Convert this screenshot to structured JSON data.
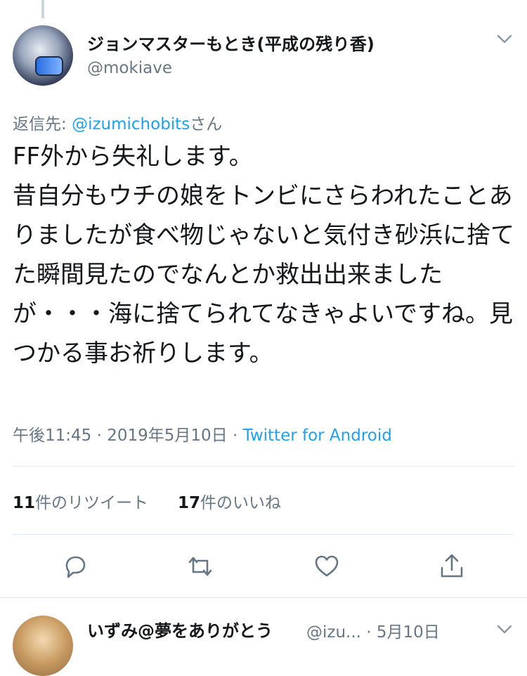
{
  "tweet": {
    "author": {
      "display_name": "ジョンマスターもとき(平成の残り香)",
      "handle": "@mokiave"
    },
    "reply_prefix": "返信先: ",
    "reply_mention": "@izumichobits",
    "reply_suffix": "さん",
    "text": "FF外から失礼します。\n昔自分もウチの娘をトンビにさらわれたことありましたが食べ物じゃないと気付き砂浜に捨てた瞬間見たのでなんとか救出出来ましたが・・・海に捨てられてなきゃよいですね。見つかる事お祈りします。",
    "timestamp": "午後11:45 · 2019年5月10日 · ",
    "source": "Twitter for Android",
    "retweets_count": "11",
    "retweets_label": "件のリツイート",
    "likes_count": "17",
    "likes_label": "件のいいね"
  },
  "actions": [
    {
      "name": "reply-icon"
    },
    {
      "name": "retweet-icon"
    },
    {
      "name": "like-icon"
    },
    {
      "name": "share-icon"
    }
  ],
  "next_reply": {
    "display_name": "いずみ@夢をありがとう",
    "handle_meta": "@izu... · 5月10日"
  },
  "colors": {
    "accent": "#1da1f2",
    "muted": "#657786",
    "text": "#14171a",
    "divider": "#e1e8ed"
  }
}
